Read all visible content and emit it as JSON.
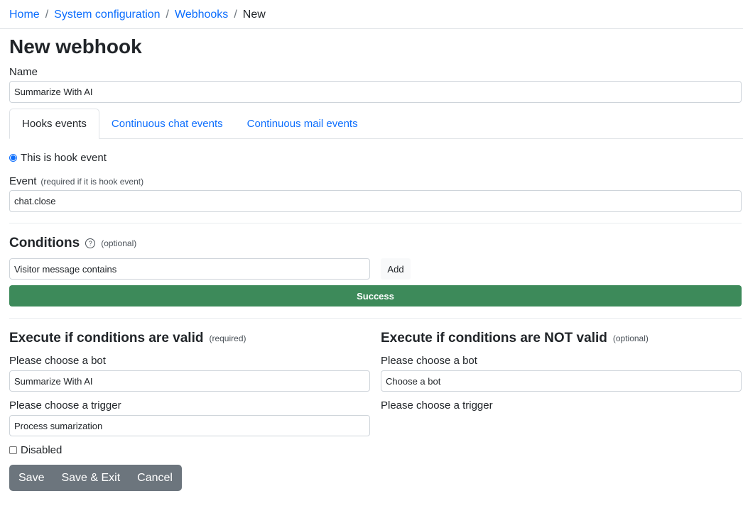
{
  "breadcrumb": {
    "home": "Home",
    "system_configuration": "System configuration",
    "webhooks": "Webhooks",
    "current": "New",
    "separator": "/"
  },
  "page_title": "New webhook",
  "name_field": {
    "label": "Name",
    "value": "Summarize With AI"
  },
  "tabs": [
    {
      "label": "Hooks events",
      "active": true
    },
    {
      "label": "Continuous chat events",
      "active": false
    },
    {
      "label": "Continuous mail events",
      "active": false
    }
  ],
  "hook_event_radio": {
    "label": "This is hook event",
    "checked": true
  },
  "event_field": {
    "label": "Event",
    "note": "(required if it is hook event)",
    "value": "chat.close"
  },
  "conditions": {
    "title": "Conditions",
    "help_icon": "?",
    "note": "(optional)",
    "input_value": "Visitor message contains",
    "add_label": "Add",
    "result_label": "Success"
  },
  "execute_valid": {
    "title": "Execute if conditions are valid",
    "note": "(required)",
    "bot_label": "Please choose a bot",
    "bot_value": "Summarize With AI",
    "trigger_label": "Please choose a trigger",
    "trigger_value": "Process sumarization"
  },
  "execute_invalid": {
    "title": "Execute if conditions are NOT valid",
    "note": "(optional)",
    "bot_label": "Please choose a bot",
    "bot_value": "Choose a bot",
    "trigger_label": "Please choose a trigger"
  },
  "disabled_checkbox": {
    "label": "Disabled",
    "checked": false
  },
  "buttons": {
    "save": "Save",
    "save_exit": "Save & Exit",
    "cancel": "Cancel"
  },
  "colors": {
    "link": "#0d6efd",
    "success": "#3d8a5a",
    "button_group": "#6c757d"
  }
}
